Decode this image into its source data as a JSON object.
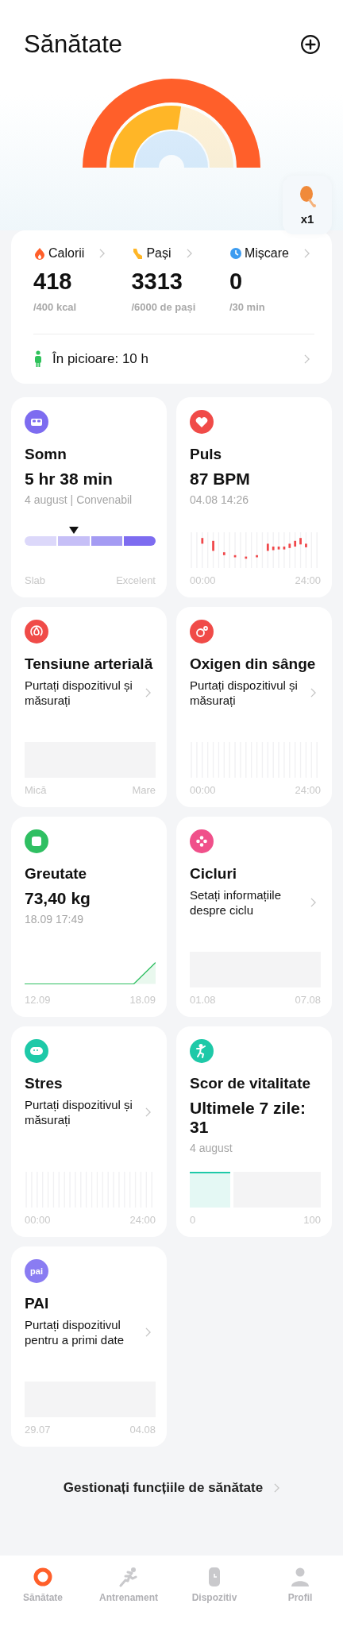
{
  "header": {
    "title": "Sănătate"
  },
  "food_badge": {
    "count": "x1"
  },
  "metrics": [
    {
      "kind": "calories",
      "label": "Calorii",
      "value": "418",
      "goal": "/400 kcal",
      "color": "#ff5f2a"
    },
    {
      "kind": "steps",
      "label": "Pași",
      "value": "3313",
      "goal": "/6000 de pași",
      "color": "#ffb627"
    },
    {
      "kind": "move",
      "label": "Mișcare",
      "value": "0",
      "goal": "/30 min",
      "color": "#3d9cf0"
    }
  ],
  "standing": {
    "label": "În picioare: 10 h"
  },
  "cards": [
    {
      "kind": "sleep",
      "color": "#7d6cf0",
      "title": "Somn",
      "value": "5 hr 38 min",
      "subtitle": "4 august | Convenabil",
      "axis": [
        "Slab",
        "Excelent"
      ]
    },
    {
      "kind": "pulse",
      "color": "#f04b48",
      "title": "Puls",
      "value": "87 BPM",
      "subtitle": "04.08 14:26",
      "axis": [
        "00:00",
        "24:00"
      ]
    },
    {
      "kind": "pressure",
      "color": "#f04b48",
      "title": "Tensiune arterială",
      "prompt": "Purtați dispozitivul și măsurați",
      "axis": [
        "Mică",
        "Mare"
      ]
    },
    {
      "kind": "oxygen",
      "color": "#f04b48",
      "title": "Oxigen din sânge",
      "prompt": "Purtați dispozitivul și măsurați",
      "axis": [
        "00:00",
        "24:00"
      ]
    },
    {
      "kind": "weight",
      "color": "#2fbf62",
      "title": "Greutate",
      "value": "73,40 kg",
      "subtitle": "18.09 17:49",
      "axis": [
        "12.09",
        "18.09"
      ]
    },
    {
      "kind": "cycle",
      "color": "#f0508a",
      "title": "Cicluri",
      "prompt": "Setați informațiile despre ciclu",
      "axis": [
        "01.08",
        "07.08"
      ]
    },
    {
      "kind": "stress",
      "color": "#1ec9a8",
      "title": "Stres",
      "prompt": "Purtați dispozitivul și măsurați",
      "axis": [
        "00:00",
        "24:00"
      ]
    },
    {
      "kind": "vitality",
      "color": "#1ec9a8",
      "title": "Scor de vitalitate",
      "value": "Ultimele 7 zile: 31",
      "subtitle": "4 august",
      "axis": [
        "0",
        "100"
      ]
    },
    {
      "kind": "pai",
      "color": "#8a7cf2",
      "icon_text": "pai",
      "title": "PAI",
      "prompt": "Purtați dispozitivul pentru a primi date",
      "axis": [
        "29.07",
        "04.08"
      ]
    }
  ],
  "manage_link": "Gestionați funcțiile de sănătate",
  "nav": [
    {
      "kind": "health",
      "label": "Sănătate",
      "selected": true
    },
    {
      "kind": "workout",
      "label": "Antrenament",
      "selected": false
    },
    {
      "kind": "device",
      "label": "Dispozitiv",
      "selected": false
    },
    {
      "kind": "profile",
      "label": "Profil",
      "selected": false
    }
  ]
}
